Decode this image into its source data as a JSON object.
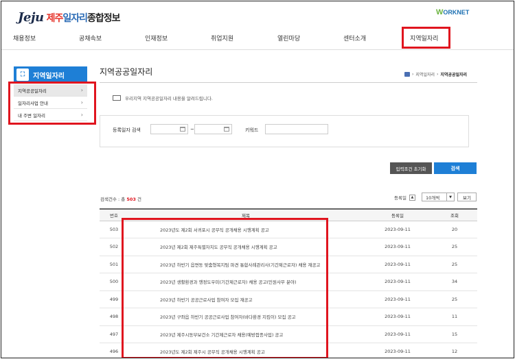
{
  "logo": {
    "en": "Jeju",
    "ko_1": "제주",
    "ko_2": "일자리",
    "ko_3": "종합정보"
  },
  "worknet": {
    "w": "W",
    "rest": "ORKNET"
  },
  "gnb": [
    "채용정보",
    "공채속보",
    "인재정보",
    "취업지원",
    "열린마당",
    "센터소개",
    "지역일자리"
  ],
  "sidebar": {
    "title": "지역일자리",
    "icon": "korea-map-icon",
    "items": [
      {
        "label": "지역공공일자리",
        "active": true
      },
      {
        "label": "일자리사업 안내",
        "active": false
      },
      {
        "label": "내 주변 일자리",
        "active": false
      }
    ]
  },
  "page": {
    "title": "지역공공일자리",
    "breadcrumb": [
      "지역일자리",
      "지역공공일자리"
    ],
    "intro": "우리지역 지역공공일자리 내용을 알려드립니다."
  },
  "search": {
    "date_label": "등록일자 검색",
    "tilde": "~",
    "keyword_label": "키워드",
    "reset_label": "입력조건 초기화",
    "search_label": "검색"
  },
  "list": {
    "count_prefix": "검색건수 : 총",
    "count": "503",
    "count_suffix": "건",
    "sort_label": "등록일",
    "sort_arrow": "▲",
    "per_page": "10개씩",
    "view_label": "보기",
    "headers": [
      "번호",
      "제목",
      "등록일",
      "조회"
    ],
    "rows": [
      [
        "503",
        "2023년도 제2회 서귀포시 공무직 공개채용 시행계획 공고",
        "2023-09-11",
        "20"
      ],
      [
        "502",
        "2023년 제2회 제주특별자치도 공무직 공개채용 시행계획 공고",
        "2023-09-11",
        "25"
      ],
      [
        "501",
        "2023년 하반기 읍면동 맞춤형복지팀 파견 통합사례관리사(기간제근로자) 채용 재공고",
        "2023-09-11",
        "25"
      ],
      [
        "500",
        "2023년 생활환경과 행정도우미(기간제근로자) 채용 공고(민원사무 분야)",
        "2023-09-11",
        "34"
      ],
      [
        "499",
        "2023년 하반기 공공근로사업 참여자 모집 재공고",
        "2023-09-11",
        "25"
      ],
      [
        "498",
        "2023년 구좌읍 하반기 공공근로사업 참여자(바다환경 지킴이) 모집 공고",
        "2023-09-11",
        "11"
      ],
      [
        "497",
        "2023년 제주시동부보건소 기간제근로자 채용(예방접종사업) 공고",
        "2023-09-11",
        "15"
      ],
      [
        "496",
        "2023년도 제2회 제주시 공무직 공개채용 시행계획 공고",
        "2023-09-11",
        "12"
      ]
    ]
  },
  "colors": {
    "accent": "#1e7fd6",
    "highlight": "#e0141e"
  }
}
